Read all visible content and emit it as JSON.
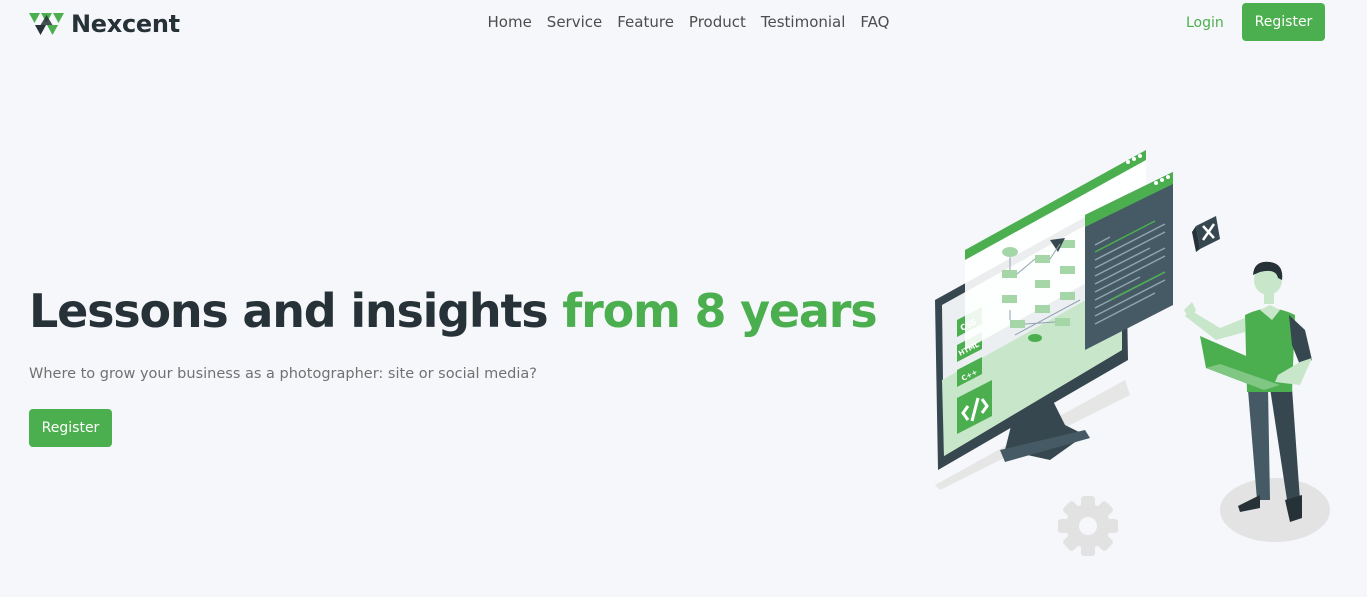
{
  "header": {
    "brand": "Nexcent",
    "nav": [
      {
        "label": "Home"
      },
      {
        "label": "Service"
      },
      {
        "label": "Feature"
      },
      {
        "label": "Product"
      },
      {
        "label": "Testimonial"
      },
      {
        "label": "FAQ"
      }
    ],
    "login_label": "Login",
    "register_label": "Register"
  },
  "hero": {
    "title_main": "Lessons and insights ",
    "title_accent": "from 8 years",
    "subtitle": "Where to grow your business as a photographer: site or social media?",
    "cta_label": "Register"
  },
  "illustration": {
    "code_badges": [
      "CSS",
      "HTML",
      "C++"
    ]
  },
  "colors": {
    "brand": "#4CAF4F",
    "heading": "#263238",
    "body_text": "#717171",
    "background": "#F5F7FA"
  },
  "icons": [
    "nexcent-logo-icon",
    "code-brackets-icon",
    "gear-icon",
    "close-icon"
  ]
}
